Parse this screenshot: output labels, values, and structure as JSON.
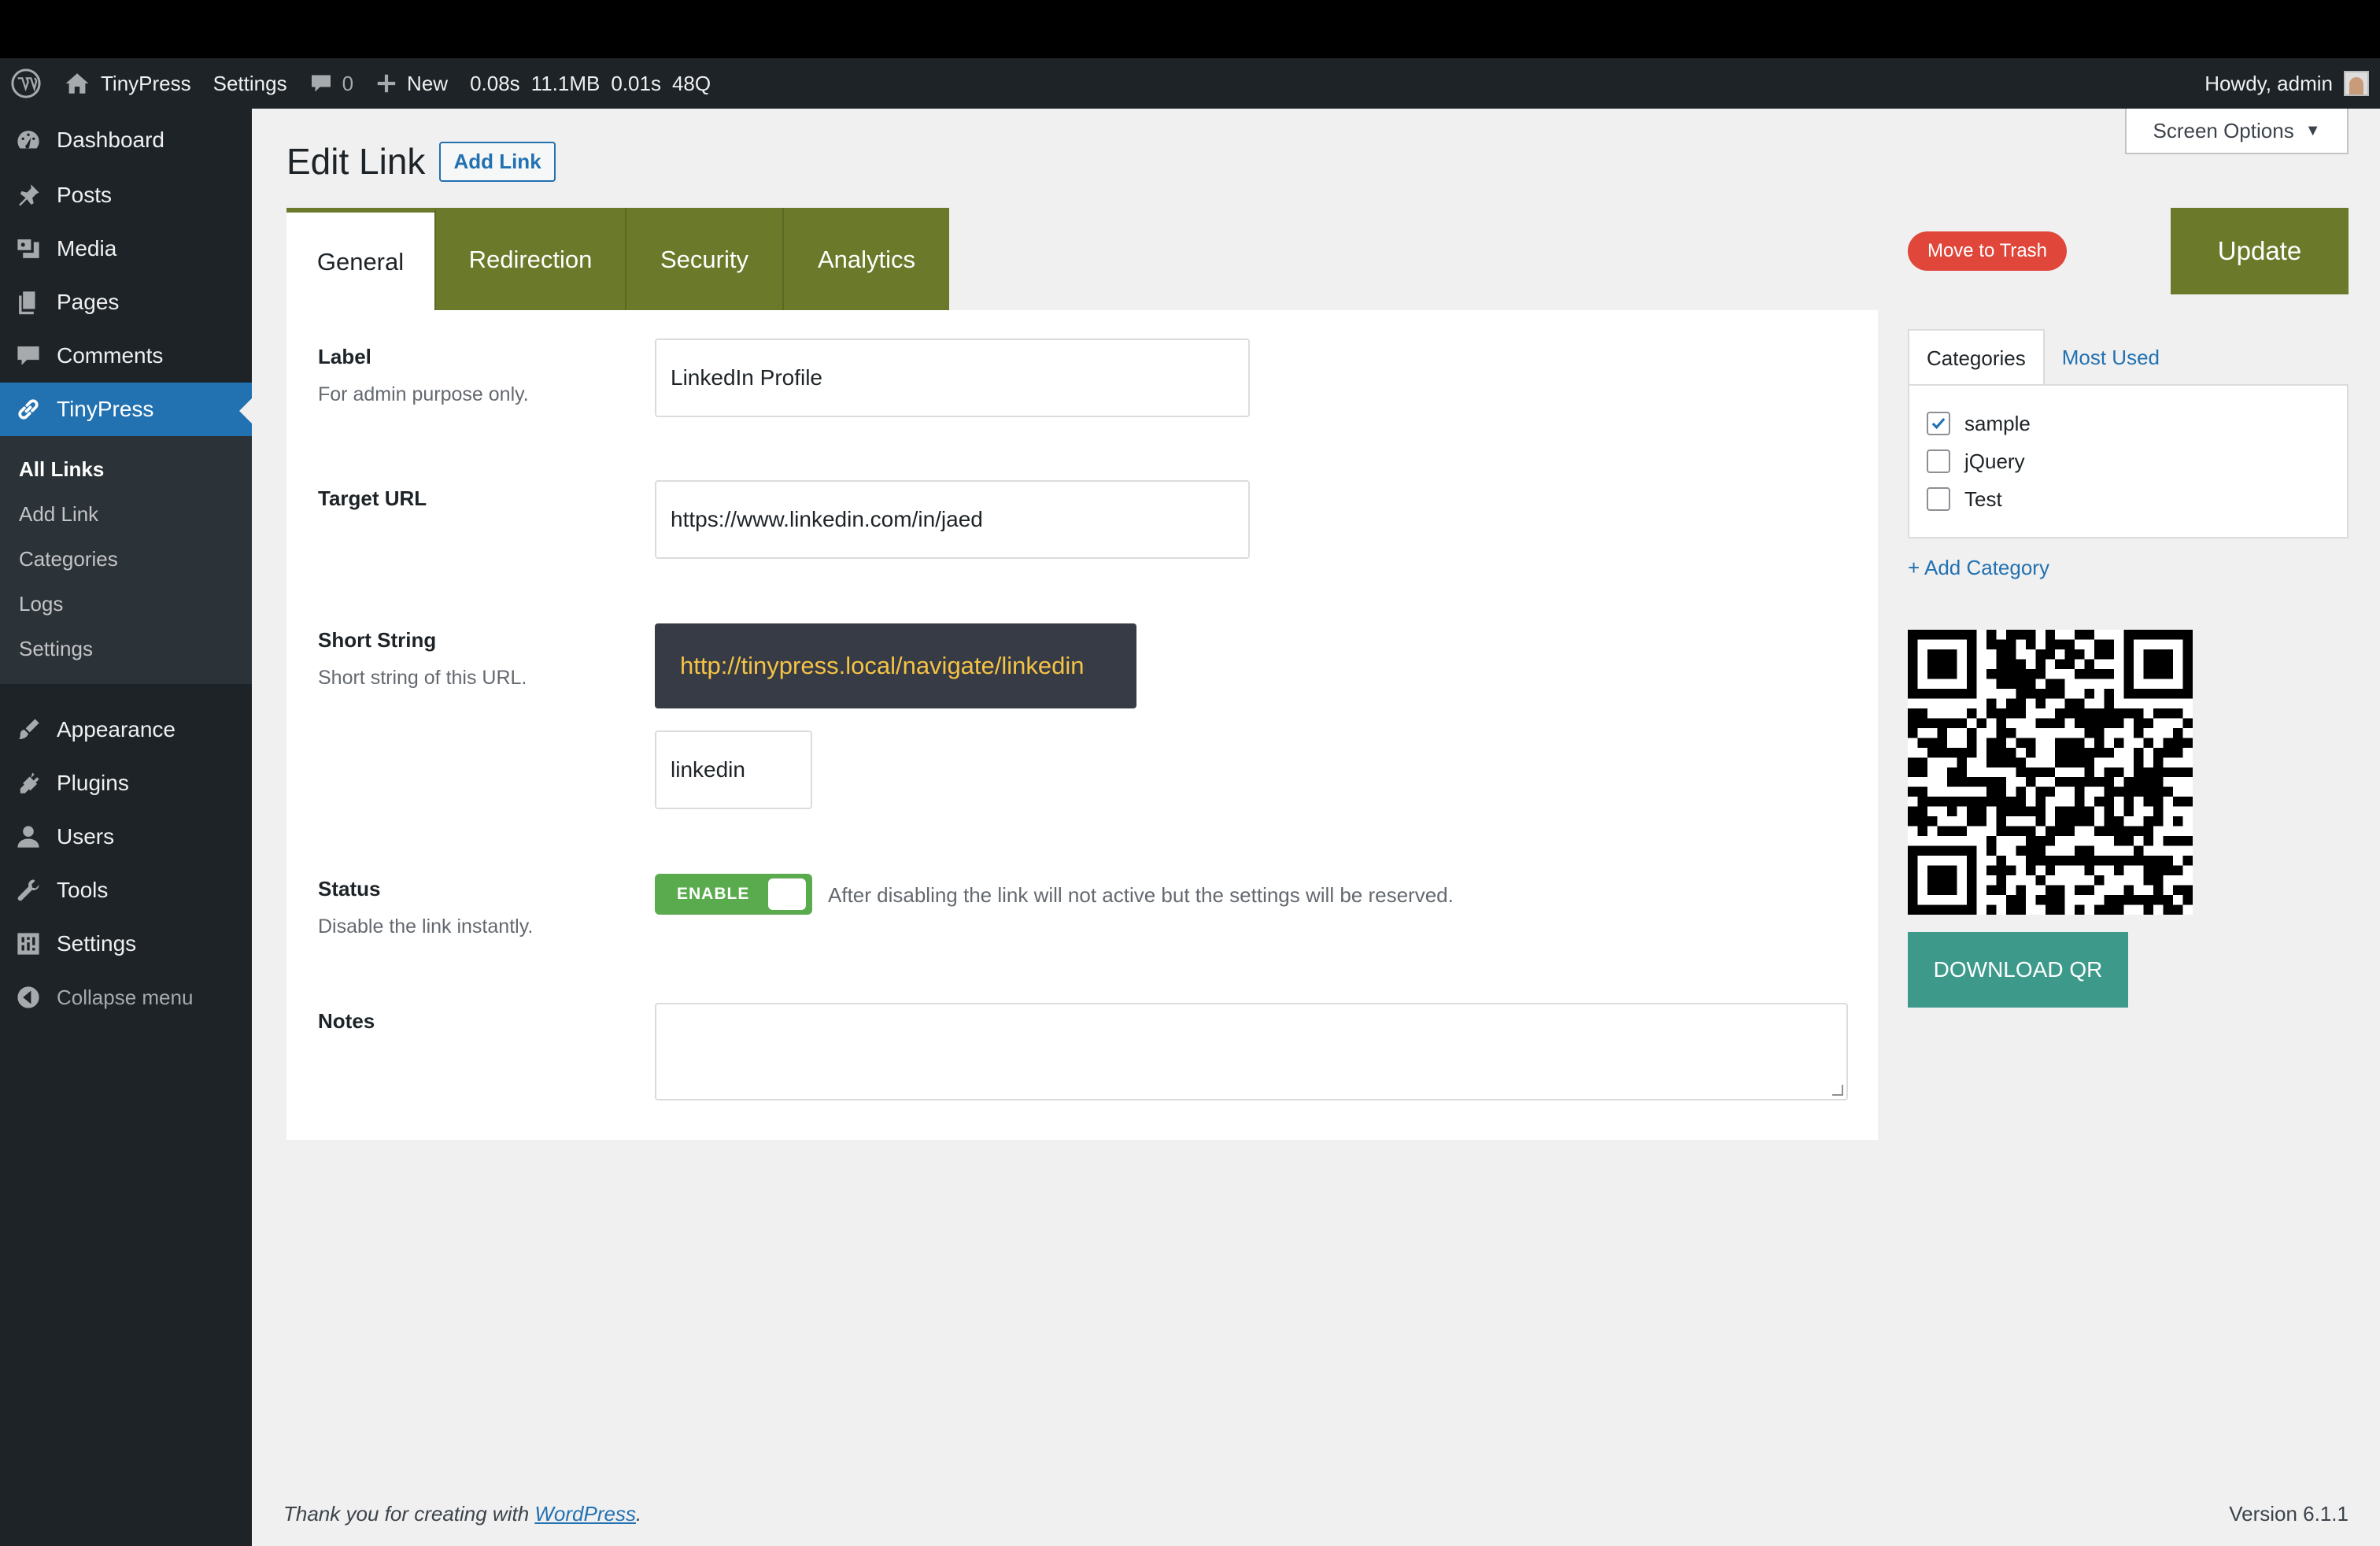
{
  "adminbar": {
    "site_name": "TinyPress",
    "settings": "Settings",
    "comments_count": "0",
    "new_label": "New",
    "perf": [
      "0.08s",
      "11.1MB",
      "0.01s",
      "48Q"
    ],
    "howdy": "Howdy, admin"
  },
  "sidebar": {
    "dashboard": "Dashboard",
    "posts": "Posts",
    "media": "Media",
    "pages": "Pages",
    "comments": "Comments",
    "tinypress": "TinyPress",
    "sub": [
      "All Links",
      "Add Link",
      "Categories",
      "Logs",
      "Settings"
    ],
    "appearance": "Appearance",
    "plugins": "Plugins",
    "users": "Users",
    "tools": "Tools",
    "settings": "Settings",
    "collapse": "Collapse menu"
  },
  "header": {
    "screen_options": "Screen Options",
    "title": "Edit Link",
    "add_link": "Add Link"
  },
  "tabs": [
    "General",
    "Redirection",
    "Security",
    "Analytics"
  ],
  "form": {
    "label_title": "Label",
    "label_desc": "For admin purpose only.",
    "label_value": "LinkedIn Profile",
    "target_title": "Target URL",
    "target_value": "https://www.linkedin.com/in/jaed",
    "short_title": "Short String",
    "short_desc": "Short string of this URL.",
    "short_url": "http://tinypress.local/navigate/linkedin",
    "short_value": "linkedin",
    "status_title": "Status",
    "status_desc": "Disable the link instantly.",
    "toggle_label": "ENABLE",
    "toggle_note": "After disabling the link will not active but the settings will be reserved.",
    "notes_title": "Notes",
    "notes_value": ""
  },
  "side": {
    "trash": "Move to Trash",
    "update": "Update",
    "cat_tab_all": "Categories",
    "cat_tab_used": "Most Used",
    "categories": [
      {
        "name": "sample",
        "checked": true
      },
      {
        "name": "jQuery",
        "checked": false
      },
      {
        "name": "Test",
        "checked": false
      }
    ],
    "add_category": "+ Add Category",
    "download_qr": "DOWNLOAD QR"
  },
  "footer": {
    "thanks_prefix": "Thank you for creating with ",
    "thanks_link": "WordPress",
    "thanks_suffix": ".",
    "version": "Version 6.1.1"
  },
  "colors": {
    "accent_olive": "#6b7a2a",
    "wp_blue": "#2271b1",
    "trash_red": "#e0463a",
    "qr_teal": "#3d9a8b",
    "toggle_green": "#5aab4e"
  }
}
